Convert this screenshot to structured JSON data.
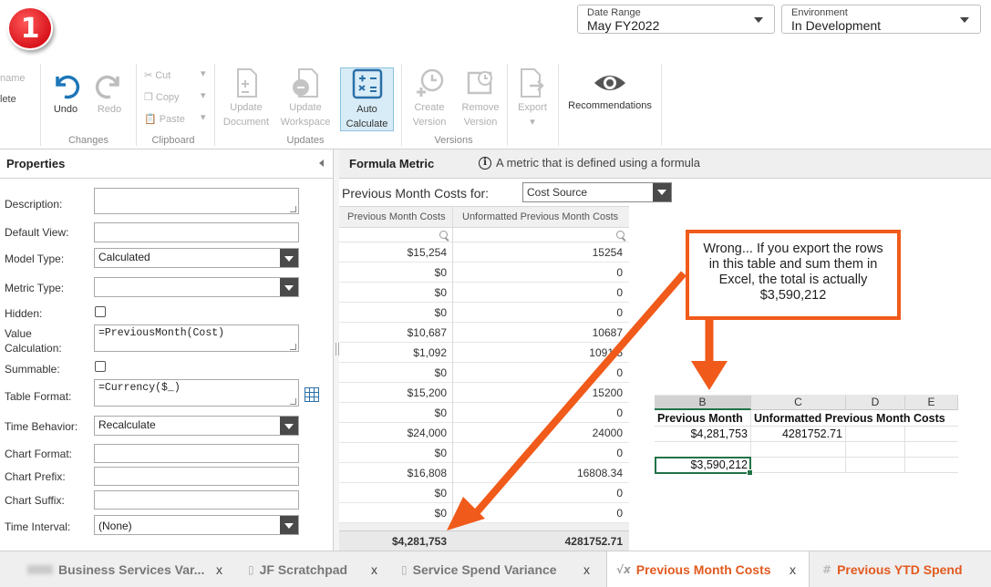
{
  "step_badge": "1",
  "date_range": {
    "label": "Date Range",
    "value": "May FY2022"
  },
  "environment": {
    "label": "Environment",
    "value": "In Development"
  },
  "ribbon": {
    "partial": {
      "name": "name",
      "delete": "lete"
    },
    "undo": "Undo",
    "redo": "Redo",
    "cut": "Cut",
    "copy": "Copy",
    "paste": "Paste",
    "update_document": [
      "Update",
      "Document"
    ],
    "update_workspace": [
      "Update",
      "Workspace"
    ],
    "auto_calculate": [
      "Auto",
      "Calculate"
    ],
    "create_version": [
      "Create",
      "Version"
    ],
    "remove_version": [
      "Remove",
      "Version"
    ],
    "export": "Export",
    "recommendations": "Recommendations",
    "groups": {
      "changes": "Changes",
      "clipboard": "Clipboard",
      "updates": "Updates",
      "versions": "Versions"
    }
  },
  "properties": {
    "title": "Properties",
    "fields": {
      "description": {
        "label": "Description:",
        "value": ""
      },
      "default_view": {
        "label": "Default View:",
        "value": ""
      },
      "model_type": {
        "label": "Model Type:",
        "value": "Calculated"
      },
      "metric_type": {
        "label": "Metric Type:",
        "value": ""
      },
      "hidden": {
        "label": "Hidden:"
      },
      "value_calc": {
        "label1": "Value",
        "label2": "Calculation:",
        "value": "=PreviousMonth(Cost)"
      },
      "summable": {
        "label": "Summable:"
      },
      "table_format": {
        "label": "Table Format:",
        "value": "=Currency($_)"
      },
      "time_behavior": {
        "label": "Time Behavior:",
        "value": "Recalculate"
      },
      "chart_format": {
        "label": "Chart Format:",
        "value": ""
      },
      "chart_prefix": {
        "label": "Chart Prefix:",
        "value": ""
      },
      "chart_suffix": {
        "label": "Chart Suffix:",
        "value": ""
      },
      "time_interval": {
        "label": "Time Interval:",
        "value": "(None)"
      }
    }
  },
  "formula_metric": {
    "title": "Formula Metric",
    "info": "A metric that is defined using a formula",
    "filter_label": "Previous Month Costs for:",
    "filter_value": "Cost Source"
  },
  "grid": {
    "columns": [
      "Previous Month Costs",
      "Unformatted Previous Month Costs"
    ],
    "rows": [
      [
        "$15,254",
        "15254"
      ],
      [
        "$0",
        "0"
      ],
      [
        "$0",
        "0"
      ],
      [
        "$0",
        "0"
      ],
      [
        "$10,687",
        "10687"
      ],
      [
        "$1,092",
        "1091.5"
      ],
      [
        "$0",
        "0"
      ],
      [
        "$15,200",
        "15200"
      ],
      [
        "$0",
        "0"
      ],
      [
        "$24,000",
        "24000"
      ],
      [
        "$0",
        "0"
      ],
      [
        "$16,808",
        "16808.34"
      ],
      [
        "$0",
        "0"
      ],
      [
        "$0",
        "0"
      ]
    ],
    "total": [
      "$4,281,753",
      "4281752.71"
    ]
  },
  "callout": "Wrong... If you export the rows in this table and sum them in Excel, the total is actually $3,590,212",
  "excel": {
    "col_headers": [
      "B",
      "C",
      "D",
      "E"
    ],
    "row1": [
      "Previous Month",
      "Unformatted Previous Month Costs"
    ],
    "row2": [
      "$4,281,753",
      "4281752.71"
    ],
    "row4": "$3,590,212"
  },
  "tabs": [
    {
      "label": "Business Services Var..."
    },
    {
      "label": "JF Scratchpad"
    },
    {
      "label": "Service Spend Variance"
    },
    {
      "label": "Previous Month Costs"
    },
    {
      "label": "Previous YTD Spend"
    }
  ],
  "tab_close": "x",
  "colors": {
    "accent_orange": "#f05a1a",
    "excel_green": "#217346",
    "badge_red": "#d9141c"
  }
}
